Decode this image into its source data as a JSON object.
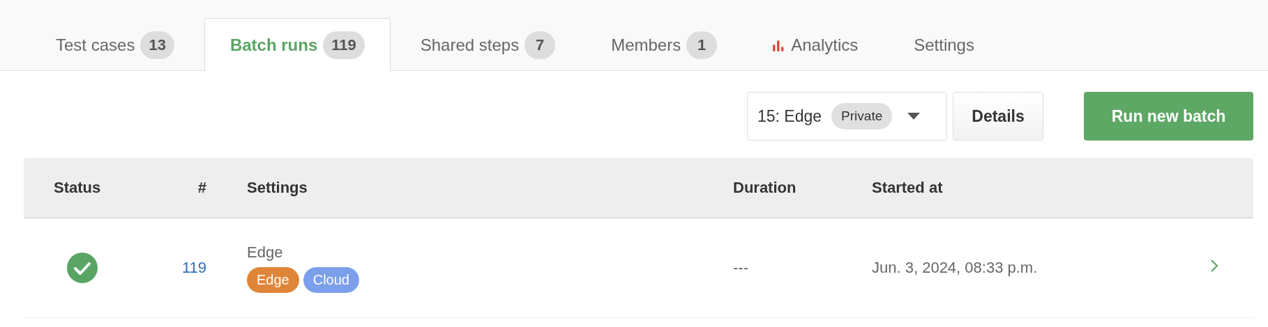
{
  "tabs": [
    {
      "label": "Test cases",
      "count": "13",
      "selected": false
    },
    {
      "label": "Batch runs",
      "count": "119",
      "selected": true
    },
    {
      "label": "Shared steps",
      "count": "7",
      "selected": false
    },
    {
      "label": "Members",
      "count": "1",
      "selected": false
    },
    {
      "label": "Analytics",
      "kind": "icon",
      "selected": false
    },
    {
      "label": "Settings",
      "selected": false
    }
  ],
  "toolbar": {
    "config_select": {
      "value": "15: Edge",
      "badge": "Private"
    },
    "details_button": "Details",
    "run_button": "Run new batch"
  },
  "table": {
    "columns": [
      "Status",
      "#",
      "Settings",
      "Duration",
      "Started at"
    ],
    "rows": [
      {
        "kind": "passed",
        "number": "119",
        "settings": "Edge",
        "tags": [
          {
            "label": "Edge",
            "color": "#df8539"
          },
          {
            "label": "Cloud",
            "color": "#7b9fea"
          }
        ],
        "duration": "---",
        "started_at": "Jun. 3, 2024, 08:33 p.m."
      }
    ]
  }
}
